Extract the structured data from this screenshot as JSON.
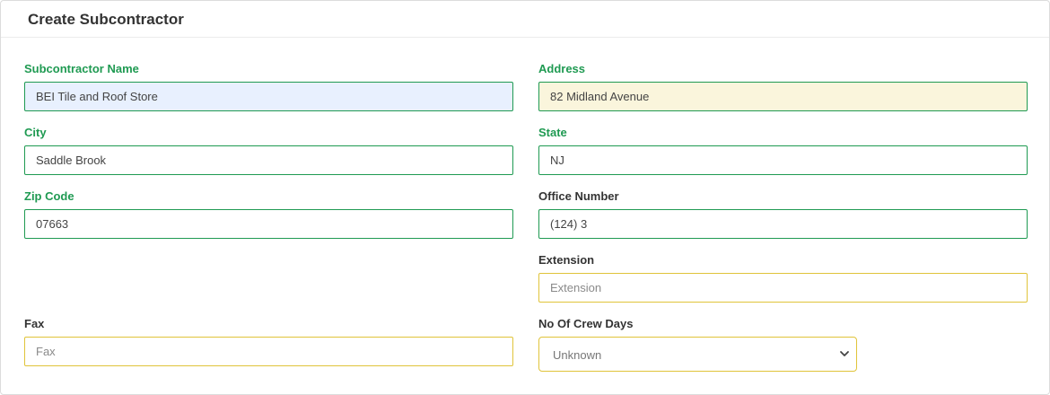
{
  "form": {
    "title": "Create Subcontractor",
    "subcontractor_name": {
      "label": "Subcontractor Name",
      "value": "BEI Tile and Roof Store"
    },
    "address": {
      "label": "Address",
      "value": "82 Midland Avenue"
    },
    "city": {
      "label": "City",
      "value": "Saddle Brook"
    },
    "state": {
      "label": "State",
      "value": "NJ"
    },
    "zip": {
      "label": "Zip Code",
      "value": "07663"
    },
    "office_number": {
      "label": "Office Number",
      "value": "(124) 3"
    },
    "extension": {
      "label": "Extension",
      "value": "",
      "placeholder": "Extension"
    },
    "fax": {
      "label": "Fax",
      "value": "",
      "placeholder": "Fax"
    },
    "crew_days": {
      "label": "No Of Crew Days",
      "selected": "Unknown"
    }
  },
  "colors": {
    "valid": "#1f9a52",
    "warning": "#e0c43a",
    "autofill_blue": "#e8f0fe",
    "autofill_cream": "#faf5dc"
  }
}
